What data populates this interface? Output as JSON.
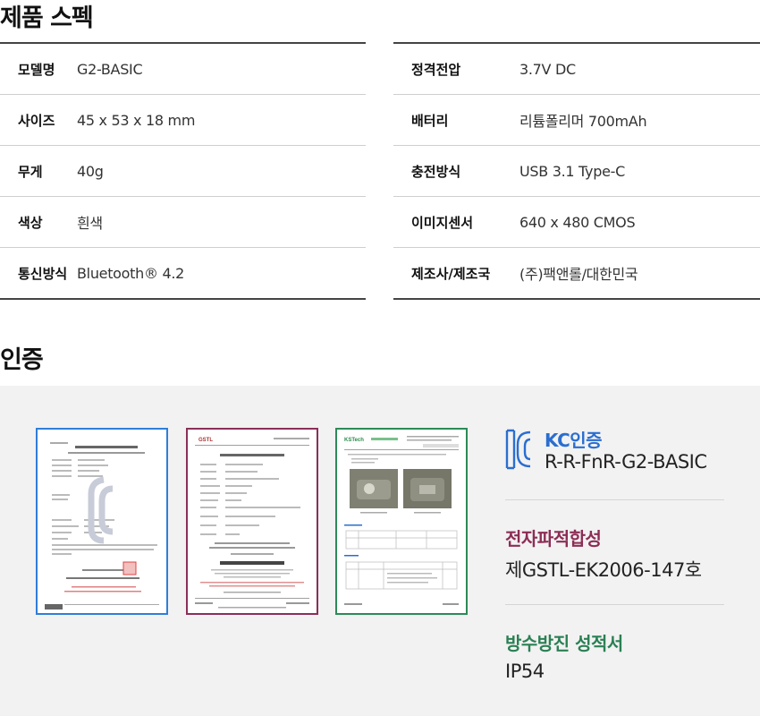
{
  "spec_section": {
    "title": "제품 스펙",
    "left": [
      {
        "label": "모델명",
        "value": "G2-BASIC"
      },
      {
        "label": "사이즈",
        "value": "45 x 53 x 18 mm"
      },
      {
        "label": "무게",
        "value": "40g"
      },
      {
        "label": "색상",
        "value": "흰색"
      },
      {
        "label": "통신방식",
        "value": "Bluetooth® 4.2"
      }
    ],
    "right": [
      {
        "label": "정격전압",
        "value": "3.7V DC"
      },
      {
        "label": "배터리",
        "value": "리튬폴리머 700mAh"
      },
      {
        "label": "충전방식",
        "value": "USB 3.1 Type-C"
      },
      {
        "label": "이미지센서",
        "value": "640 x 480 CMOS"
      },
      {
        "label": "제조사/제조국",
        "value": "(주)팩앤롤/대한민국"
      }
    ]
  },
  "cert_section": {
    "title": "인증",
    "kc": {
      "name": "KC인증",
      "value": "R-R-FnR-G2-BASIC"
    },
    "emc": {
      "name": "전자파적합성",
      "value": "제GSTL-EK2006-147호"
    },
    "ip": {
      "name": "방수방진 성적서",
      "value": "IP54"
    },
    "docs": {
      "d2_logo": "GSTL",
      "d3_logo": "KSTech"
    },
    "colors": {
      "kc": "#2a6ed0",
      "emc": "#8c2d55",
      "ip": "#2b8054"
    }
  }
}
